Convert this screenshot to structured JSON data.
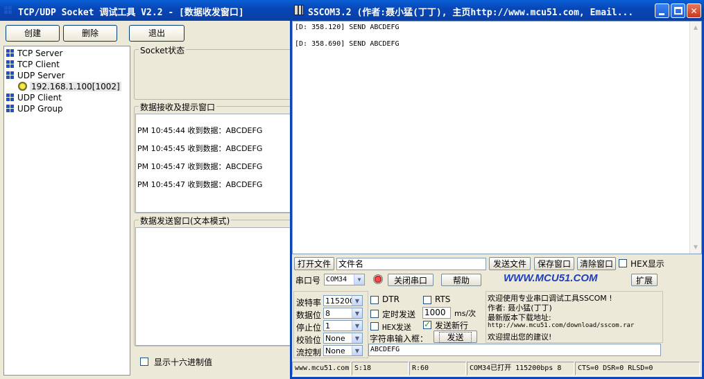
{
  "left_window": {
    "title": "TCP/UDP Socket 调试工具 V2.2 - [数据收发窗口]",
    "buttons": {
      "create": "创建",
      "delete": "删除",
      "exit": "退出"
    },
    "tree": {
      "tcp_server": "TCP Server",
      "tcp_client": "TCP Client",
      "udp_server": "UDP Server",
      "udp_server_child": "192.168.1.100[1002]",
      "udp_client": "UDP Client",
      "udp_group": "UDP Group"
    },
    "socket_status_label": "Socket状态",
    "recv_label": "数据接收及提示窗口",
    "recv_lines": [
      "PM 10:45:44 收到数据：ABCDEFG",
      "PM 10:45:45 收到数据：ABCDEFG",
      "PM 10:45:47 收到数据：ABCDEFG",
      "PM 10:45:47 收到数据：ABCDEFG"
    ],
    "send_label": "数据发送窗口(文本模式)",
    "show_hex_label": "显示十六进制值"
  },
  "right_window": {
    "title": "SSCOM3.2 (作者:聂小猛(丁丁), 主页http://www.mcu51.com,  Email...",
    "log_lines": [
      "[D: 358.120] SEND ABCDEFG",
      "[D: 358.690] SEND ABCDEFG"
    ],
    "open_file_button": "打开文件",
    "filename_value": "文件名",
    "send_file_button": "发送文件",
    "save_window_button": "保存窗口",
    "clear_window_button": "清除窗口",
    "hex_display_label": "HEX显示",
    "port_label": "串口号",
    "port_value": "COM34",
    "close_port_button": "关闭串口",
    "help_button": "帮助",
    "brand": "WWW.MCU51.COM",
    "expand_button": "扩展",
    "baud_label": "波特率",
    "baud_value": "115200",
    "databits_label": "数据位",
    "databits_value": "8",
    "stopbits_label": "停止位",
    "stopbits_value": "1",
    "parity_label": "校验位",
    "parity_value": "None",
    "flow_label": "流控制",
    "flow_value": "None",
    "dtr_label": "DTR",
    "rts_label": "RTS",
    "timed_send_label": "定时发送",
    "interval_value": "1000",
    "interval_unit": "ms/次",
    "hex_send_label": "HEX发送",
    "send_newline_label": "发送新行",
    "string_input_label": "字符串输入框：",
    "send_button": "发送",
    "send_input_value": "ABCDEFG",
    "info_lines": [
      "欢迎使用专业串口调试工具SSCOM !",
      "作者: 聂小猛(丁丁)",
      "最新版本下载地址:",
      "http://www.mcu51.com/download/sscom.rar",
      "欢迎提出您的建议!"
    ],
    "status": {
      "site": "www.mcu51.com",
      "sent": "S:18",
      "recv": "R:60",
      "port_state": "COM34已打开  115200bps  8",
      "lines": "CTS=0 DSR=0 RLSD=0"
    }
  },
  "colors": {
    "title_blue": "#0a5fd6",
    "brand_blue": "#1f3fb8",
    "close_red": "#d9462c"
  }
}
